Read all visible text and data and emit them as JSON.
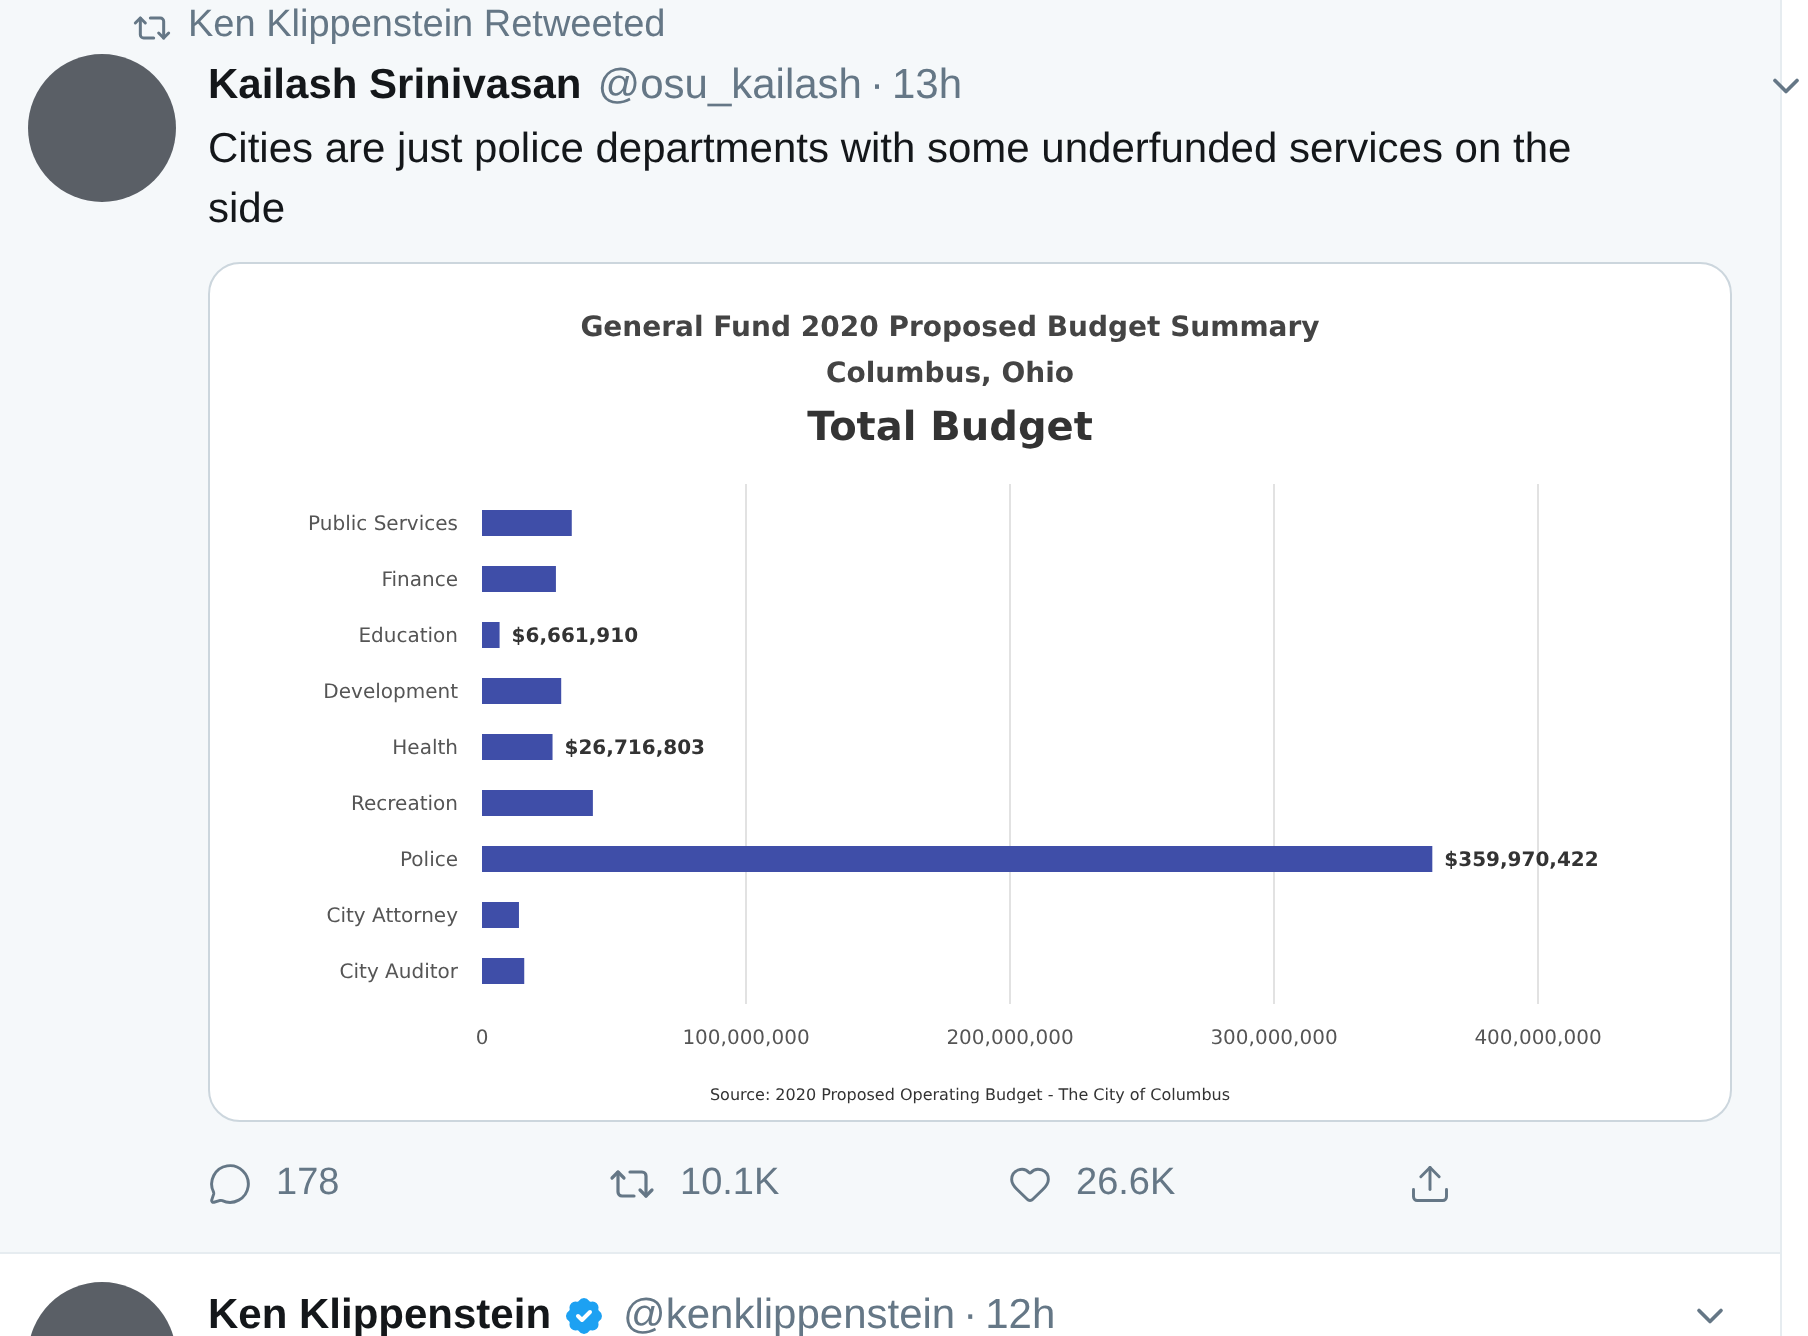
{
  "retweet_note": {
    "label": "Ken Klippenstein Retweeted"
  },
  "tweet": {
    "author": "Kailash Srinivasan",
    "handle": "@osu_kailash",
    "separator": "·",
    "time": "13h",
    "text": "Cities are just police departments with some underfunded services on the side",
    "chart_image": {
      "subtitle": "Columbus, Ohio",
      "heading": "Total Budget",
      "source": "Source: 2020 Proposed Operating Budget - The City of Columbus",
      "chart_data": {
        "type": "bar",
        "orientation": "horizontal",
        "title": "General Fund 2020 Proposed Budget Summary",
        "grid": true,
        "categories": [
          "Public Services",
          "Finance",
          "Education",
          "Development",
          "Health",
          "Recreation",
          "Police",
          "City Attorney",
          "City Auditor"
        ],
        "values": [
          34000000,
          28000000,
          6661910,
          30000000,
          26716803,
          42000000,
          359970422,
          14000000,
          16000000
        ],
        "value_labels": [
          null,
          null,
          "$6,661,910",
          null,
          "$26,716,803",
          null,
          "$359,970,422",
          null,
          null
        ],
        "xlim": [
          0,
          400000000
        ],
        "xticks": [
          {
            "value": 0,
            "label": "0"
          },
          {
            "value": 100000000,
            "label": "100,000,000"
          },
          {
            "value": 200000000,
            "label": "200,000,000"
          },
          {
            "value": 300000000,
            "label": "300,000,000"
          },
          {
            "value": 400000000,
            "label": "400,000,000"
          }
        ]
      }
    },
    "actions": [
      {
        "kind": "reply",
        "count": "178"
      },
      {
        "kind": "retweet",
        "count": "10.1K"
      },
      {
        "kind": "like",
        "count": "26.6K"
      },
      {
        "kind": "share"
      }
    ]
  },
  "next_tweet": {
    "author": "Ken Klippenstein",
    "verified": true,
    "handle": "@kenklippenstein",
    "separator": "·",
    "time": "12h"
  }
}
